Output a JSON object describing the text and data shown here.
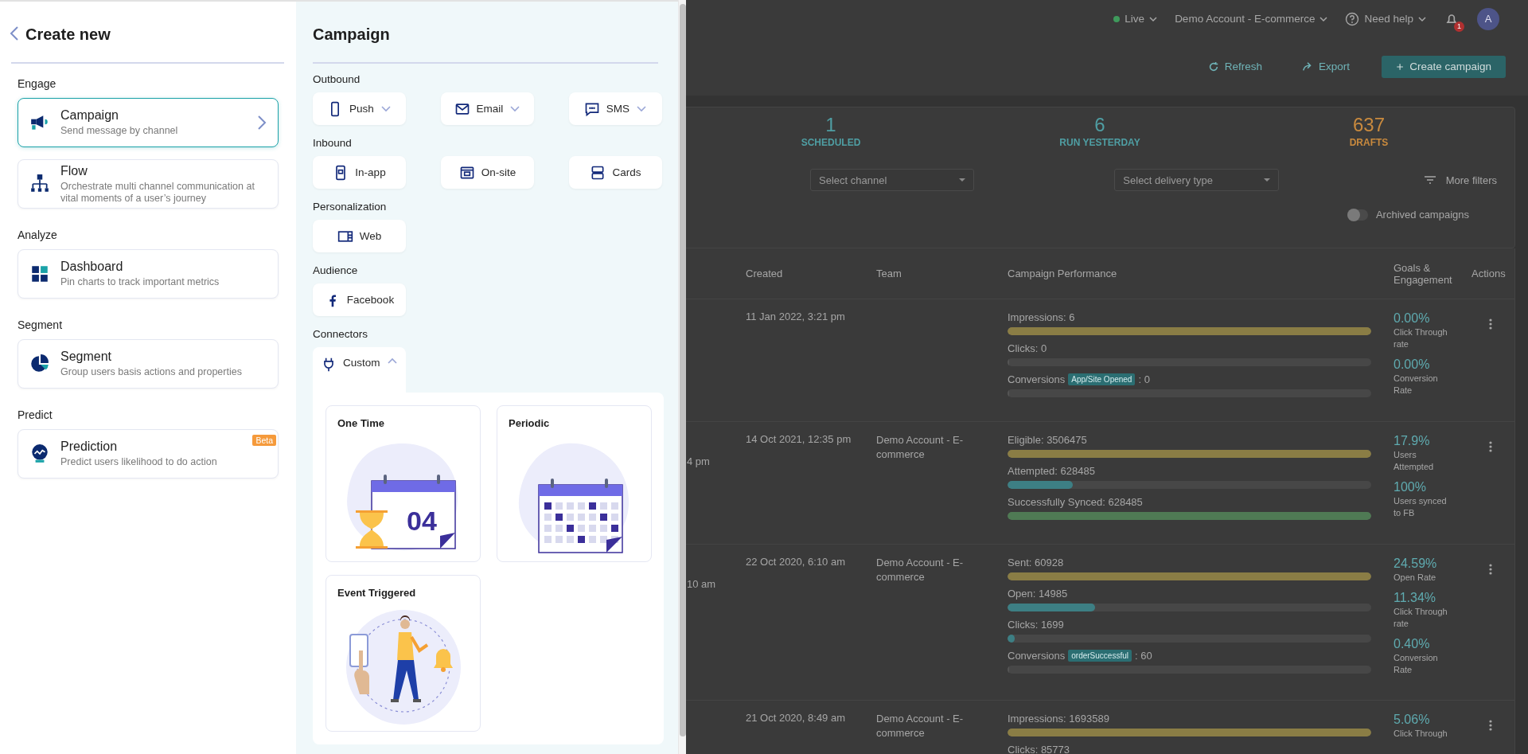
{
  "create_panel": {
    "title": "Create new",
    "groups": [
      {
        "heading": "Engage",
        "items": [
          {
            "kind": "campaign",
            "title": "Campaign",
            "description": "Send message by channel",
            "selected": true
          },
          {
            "kind": "flow",
            "title": "Flow",
            "description": "Orchestrate multi channel communication at vital moments of a user’s journey",
            "selected": false
          }
        ]
      },
      {
        "heading": "Analyze",
        "items": [
          {
            "kind": "dashboard",
            "title": "Dashboard",
            "description": "Pin charts to track important metrics",
            "selected": false
          }
        ]
      },
      {
        "heading": "Segment",
        "items": [
          {
            "kind": "segment",
            "title": "Segment",
            "description": "Group users basis actions and properties",
            "selected": false
          }
        ]
      },
      {
        "heading": "Predict",
        "items": [
          {
            "kind": "prediction",
            "title": "Prediction",
            "description": "Predict users likelihood to do action",
            "selected": false,
            "badge": "Beta"
          }
        ]
      }
    ]
  },
  "campaign_panel": {
    "title": "Campaign",
    "sections": [
      {
        "heading": "Outbound",
        "options": [
          {
            "kind": "push",
            "label": "Push",
            "expanded": false
          },
          {
            "kind": "email",
            "label": "Email",
            "expanded": false
          },
          {
            "kind": "sms",
            "label": "SMS",
            "expanded": false
          }
        ]
      },
      {
        "heading": "Inbound",
        "options": [
          {
            "kind": "in_app",
            "label": "In-app"
          },
          {
            "kind": "on_site",
            "label": "On-site"
          },
          {
            "kind": "cards",
            "label": "Cards"
          }
        ]
      },
      {
        "heading": "Personalization",
        "options": [
          {
            "kind": "web",
            "label": "Web"
          }
        ]
      },
      {
        "heading": "Audience",
        "options": [
          {
            "kind": "facebook",
            "label": "Facebook"
          }
        ]
      },
      {
        "heading": "Connectors",
        "options": [
          {
            "kind": "plug",
            "label": "Custom",
            "expanded": true,
            "delivery_types": [
              {
                "kind": "one_time",
                "label": "One Time",
                "date": "04"
              },
              {
                "kind": "periodic",
                "label": "Periodic"
              },
              {
                "kind": "event",
                "label": "Event Triggered"
              }
            ]
          }
        ]
      }
    ]
  },
  "background": {
    "top_bar": {
      "environment": "Live",
      "account": "Demo Account - E-commerce",
      "help": "Need help",
      "notifications": "1",
      "avatar": "A"
    },
    "actions": [
      {
        "kind": "refresh",
        "label": "Refresh"
      },
      {
        "kind": "export",
        "label": "Export"
      },
      {
        "kind": "create",
        "label": "Create campaign"
      }
    ],
    "stats": [
      {
        "value": "1",
        "label": "SCHEDULED",
        "color": "#4f9ea3"
      },
      {
        "value": "6",
        "label": "RUN YESTERDAY",
        "color": "#4f9ea3"
      },
      {
        "value": "637",
        "label": "DRAFTS",
        "color": "#c98a3e"
      }
    ],
    "filters": [
      {
        "placeholder": "Select channel"
      },
      {
        "placeholder": "Select delivery type"
      }
    ],
    "more_filters": "More filters",
    "archived": {
      "label": "Archived campaigns",
      "on": false
    },
    "table": {
      "columns": [
        {
          "label": "Created"
        },
        {
          "label": "Team"
        },
        {
          "label": "Campaign Performance"
        },
        {
          "label": "Goals & Engagement"
        },
        {
          "label": "Actions"
        }
      ],
      "rows": [
        {
          "created": "11 Jan 2022, 3:21 pm",
          "metrics": [
            {
              "label": "Impressions: 6",
              "level": 1,
              "color": "#8a7d45"
            },
            {
              "label": "Clicks: 0",
              "level": 0
            },
            {
              "label": "Conversions",
              "tag": "App/Site Opened",
              "count": ": 0",
              "level": 0
            }
          ],
          "goals": [
            {
              "value": "0.00%",
              "label": "Click Through rate"
            },
            {
              "value": "0.00%",
              "label": "Conversion Rate"
            }
          ]
        },
        {
          "column_1": "4 pm",
          "created": "14 Oct 2021, 12:35 pm",
          "team": "Demo Account - E-commerce",
          "metrics": [
            {
              "label": "Eligible: 3506475",
              "level": 1,
              "color": "#8a7d45"
            },
            {
              "label": "Attempted: 628485",
              "level": 0.18,
              "color": "#3d7f84"
            },
            {
              "label": "Successfully Synced: 628485",
              "level": 1,
              "color": "#4f7a54"
            }
          ],
          "goals": [
            {
              "value": "17.9%",
              "label": "Users Attempted"
            },
            {
              "value": "100%",
              "label": "Users synced to FB"
            }
          ]
        },
        {
          "column_1": "10 am",
          "created": "22 Oct 2020, 6:10 am",
          "team": "Demo Account - E-commerce",
          "metrics": [
            {
              "label": "Sent: 60928",
              "level": 1,
              "color": "#8a7d45"
            },
            {
              "label": "Open: 14985",
              "level": 0.24,
              "color": "#3d7f84"
            },
            {
              "label": "Clicks: 1699",
              "level": 0.02,
              "color": "#3d7f84"
            },
            {
              "label": "Conversions",
              "tag": "orderSuccessful",
              "count": ": 60",
              "level": 0
            }
          ],
          "goals": [
            {
              "value": "24.59%",
              "label": "Open Rate"
            },
            {
              "value": "11.34%",
              "label": "Click Through rate"
            },
            {
              "value": "0.40%",
              "label": "Conversion Rate"
            }
          ]
        },
        {
          "created": "21 Oct 2020, 8:49 am",
          "team": "Demo Account - E-commerce",
          "metrics": [
            {
              "label": "Impressions: 1693589",
              "level": 1,
              "color": "#8a7d45"
            },
            {
              "label": "Clicks: 85773"
            }
          ],
          "goals": [
            {
              "value": "5.06%",
              "label": "Click Through"
            }
          ]
        }
      ]
    }
  }
}
